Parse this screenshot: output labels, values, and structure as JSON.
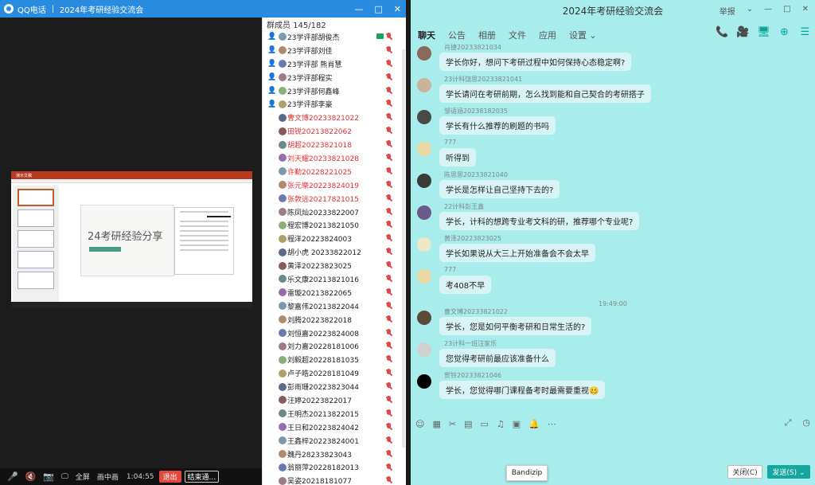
{
  "call_window": {
    "app_name": "QQ电话",
    "title": "2024年考研经验交流会",
    "controls": [
      "—",
      "□",
      "✕"
    ],
    "toolbar": {
      "fullscreen": "全屏",
      "pip": "画中画",
      "timer": "1:04:55",
      "exit": "退出",
      "end": "结束通..."
    },
    "shared_screen": {
      "slide_title": "24考研经验分享",
      "ribbon": "演示文稿"
    },
    "members": {
      "header": "群成员 145/182",
      "items": [
        {
          "name": "23学评部胡俊杰",
          "red": false,
          "section": true
        },
        {
          "name": "23学评部刘佳",
          "red": false,
          "section": true
        },
        {
          "name": "23学评部 熊肖慧",
          "red": false,
          "section": true
        },
        {
          "name": "23学评部程实",
          "red": false,
          "section": true
        },
        {
          "name": "23学评部何鑫峰",
          "red": false,
          "section": true
        },
        {
          "name": "23学评部李豪",
          "red": false,
          "section": true
        },
        {
          "name": "曹文博20233821022",
          "red": true,
          "section": false
        },
        {
          "name": "田锐20213822062",
          "red": true,
          "section": false
        },
        {
          "name": "胡超20223821018",
          "red": true,
          "section": false
        },
        {
          "name": "刘天耀20233821028",
          "red": true,
          "section": false
        },
        {
          "name": "许勤20228221025",
          "red": true,
          "section": false
        },
        {
          "name": "张元樂20223824019",
          "red": true,
          "section": false
        },
        {
          "name": "张敦远20217821015",
          "red": true,
          "section": false
        },
        {
          "name": "陈凤灿20233822007",
          "red": false,
          "section": false
        },
        {
          "name": "程宏博20213821050",
          "red": false,
          "section": false
        },
        {
          "name": "程洋20223824003",
          "red": false,
          "section": false
        },
        {
          "name": "胡小虎 20233822012",
          "red": false,
          "section": false
        },
        {
          "name": "黄泽20223823025",
          "red": false,
          "section": false
        },
        {
          "name": "乐文康20213821016",
          "red": false,
          "section": false
        },
        {
          "name": "雷璇20213822065",
          "red": false,
          "section": false
        },
        {
          "name": "黎嘉伟20213822044",
          "red": false,
          "section": false
        },
        {
          "name": "刘腾20223822018",
          "red": false,
          "section": false
        },
        {
          "name": "刘恒嘉20223824008",
          "red": false,
          "section": false
        },
        {
          "name": "刘力嘉20228181006",
          "red": false,
          "section": false
        },
        {
          "name": "刘毅超20228181035",
          "red": false,
          "section": false
        },
        {
          "name": "卢子皓20228181049",
          "red": false,
          "section": false
        },
        {
          "name": "彭雨珊20223823044",
          "red": false,
          "section": false
        },
        {
          "name": "汪婷20223822017",
          "red": false,
          "section": false
        },
        {
          "name": "王明杰20213822015",
          "red": false,
          "section": false
        },
        {
          "name": "王日和20223824042",
          "red": false,
          "section": false
        },
        {
          "name": "王鑫梓20223824001",
          "red": false,
          "section": false
        },
        {
          "name": "魏丹28233823043",
          "red": false,
          "section": false
        },
        {
          "name": "翁丽萍20228182013",
          "red": false,
          "section": false
        },
        {
          "name": "吴姿20218181077",
          "red": false,
          "section": false
        }
      ]
    }
  },
  "chat_window": {
    "title": "2024年考研经验交流会",
    "controls": [
      "举报",
      "⌄",
      "—",
      "□",
      "✕"
    ],
    "tabs": [
      "聊天",
      "公告",
      "相册",
      "文件",
      "应用",
      "设置 ⌄"
    ],
    "messages": [
      {
        "sender": "肖捷20233821034",
        "text": "学长你好，想问下考研过程中如何保持心态稳定啊?",
        "avatar_color": "#8a6a5a"
      },
      {
        "sender": "23计科饶思20233821041",
        "text": "学长请问在考研前期，怎么找到能和自己契合的考研搭子",
        "avatar_color": "#c9b39a"
      },
      {
        "sender": "邹语涵20238182035",
        "text": "学长有什么推荐的刷题的书吗",
        "avatar_color": "#4a4a4a"
      },
      {
        "sender": "777",
        "text": "听得到",
        "avatar_color": "#e8d9a0"
      },
      {
        "sender": "陈思思20233821040",
        "text": "学长是怎样让自己坚持下去的?",
        "avatar_color": "#3a3a3a"
      },
      {
        "sender": "22计科彭王鑫",
        "text": "学长，计科的想跨专业考文科的研，推荐哪个专业呢?",
        "avatar_color": "#6a5a8a"
      },
      {
        "sender": "黄泽20223823025",
        "text": "学长如果说从大三上开始准备会不会太早",
        "avatar_color": "#f0e6c8"
      },
      {
        "sender": "777",
        "text": "考408不早",
        "avatar_color": "#e8d9a0"
      },
      {
        "sender": "曹文博20233821022",
        "text": "学长，您是如何平衡考研和日常生活的?",
        "avatar_color": "#5a4a3a"
      },
      {
        "sender": "23计科一班汪家乐",
        "text": "您觉得考研前最应该准备什么",
        "avatar_color": "#d0d0d0"
      },
      {
        "sender": "贺铃20233821046",
        "text": "学长，您觉得哪门课程备考时最需要重视🥴",
        "avatar_color": "#000000"
      }
    ],
    "time_separator": "19:49:00",
    "close_button": "关闭(C)",
    "send_button": "发送(S) ⌄",
    "tooltip": "Bandizip"
  }
}
